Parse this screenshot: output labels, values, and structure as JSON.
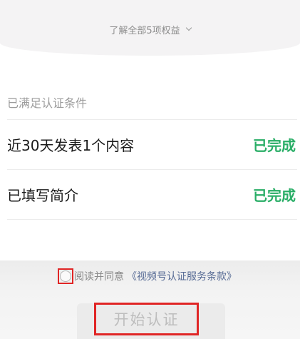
{
  "header": {
    "benefits_link": "了解全部5项权益"
  },
  "requirements": {
    "section_title": "已满足认证条件",
    "items": [
      {
        "label": "近30天发表1个内容",
        "status": "已完成"
      },
      {
        "label": "已填写简介",
        "status": "已完成"
      }
    ],
    "status_color": "#2aae67"
  },
  "agreement": {
    "text": "阅读并同意",
    "link": "《视频号认证服务条款》",
    "checked": false
  },
  "start_button": {
    "label": "开始认证",
    "enabled": false
  },
  "icons": {
    "expand": "chevron-down-icon",
    "agree": "radio-unchecked-icon"
  },
  "highlight_color": "#e02525"
}
